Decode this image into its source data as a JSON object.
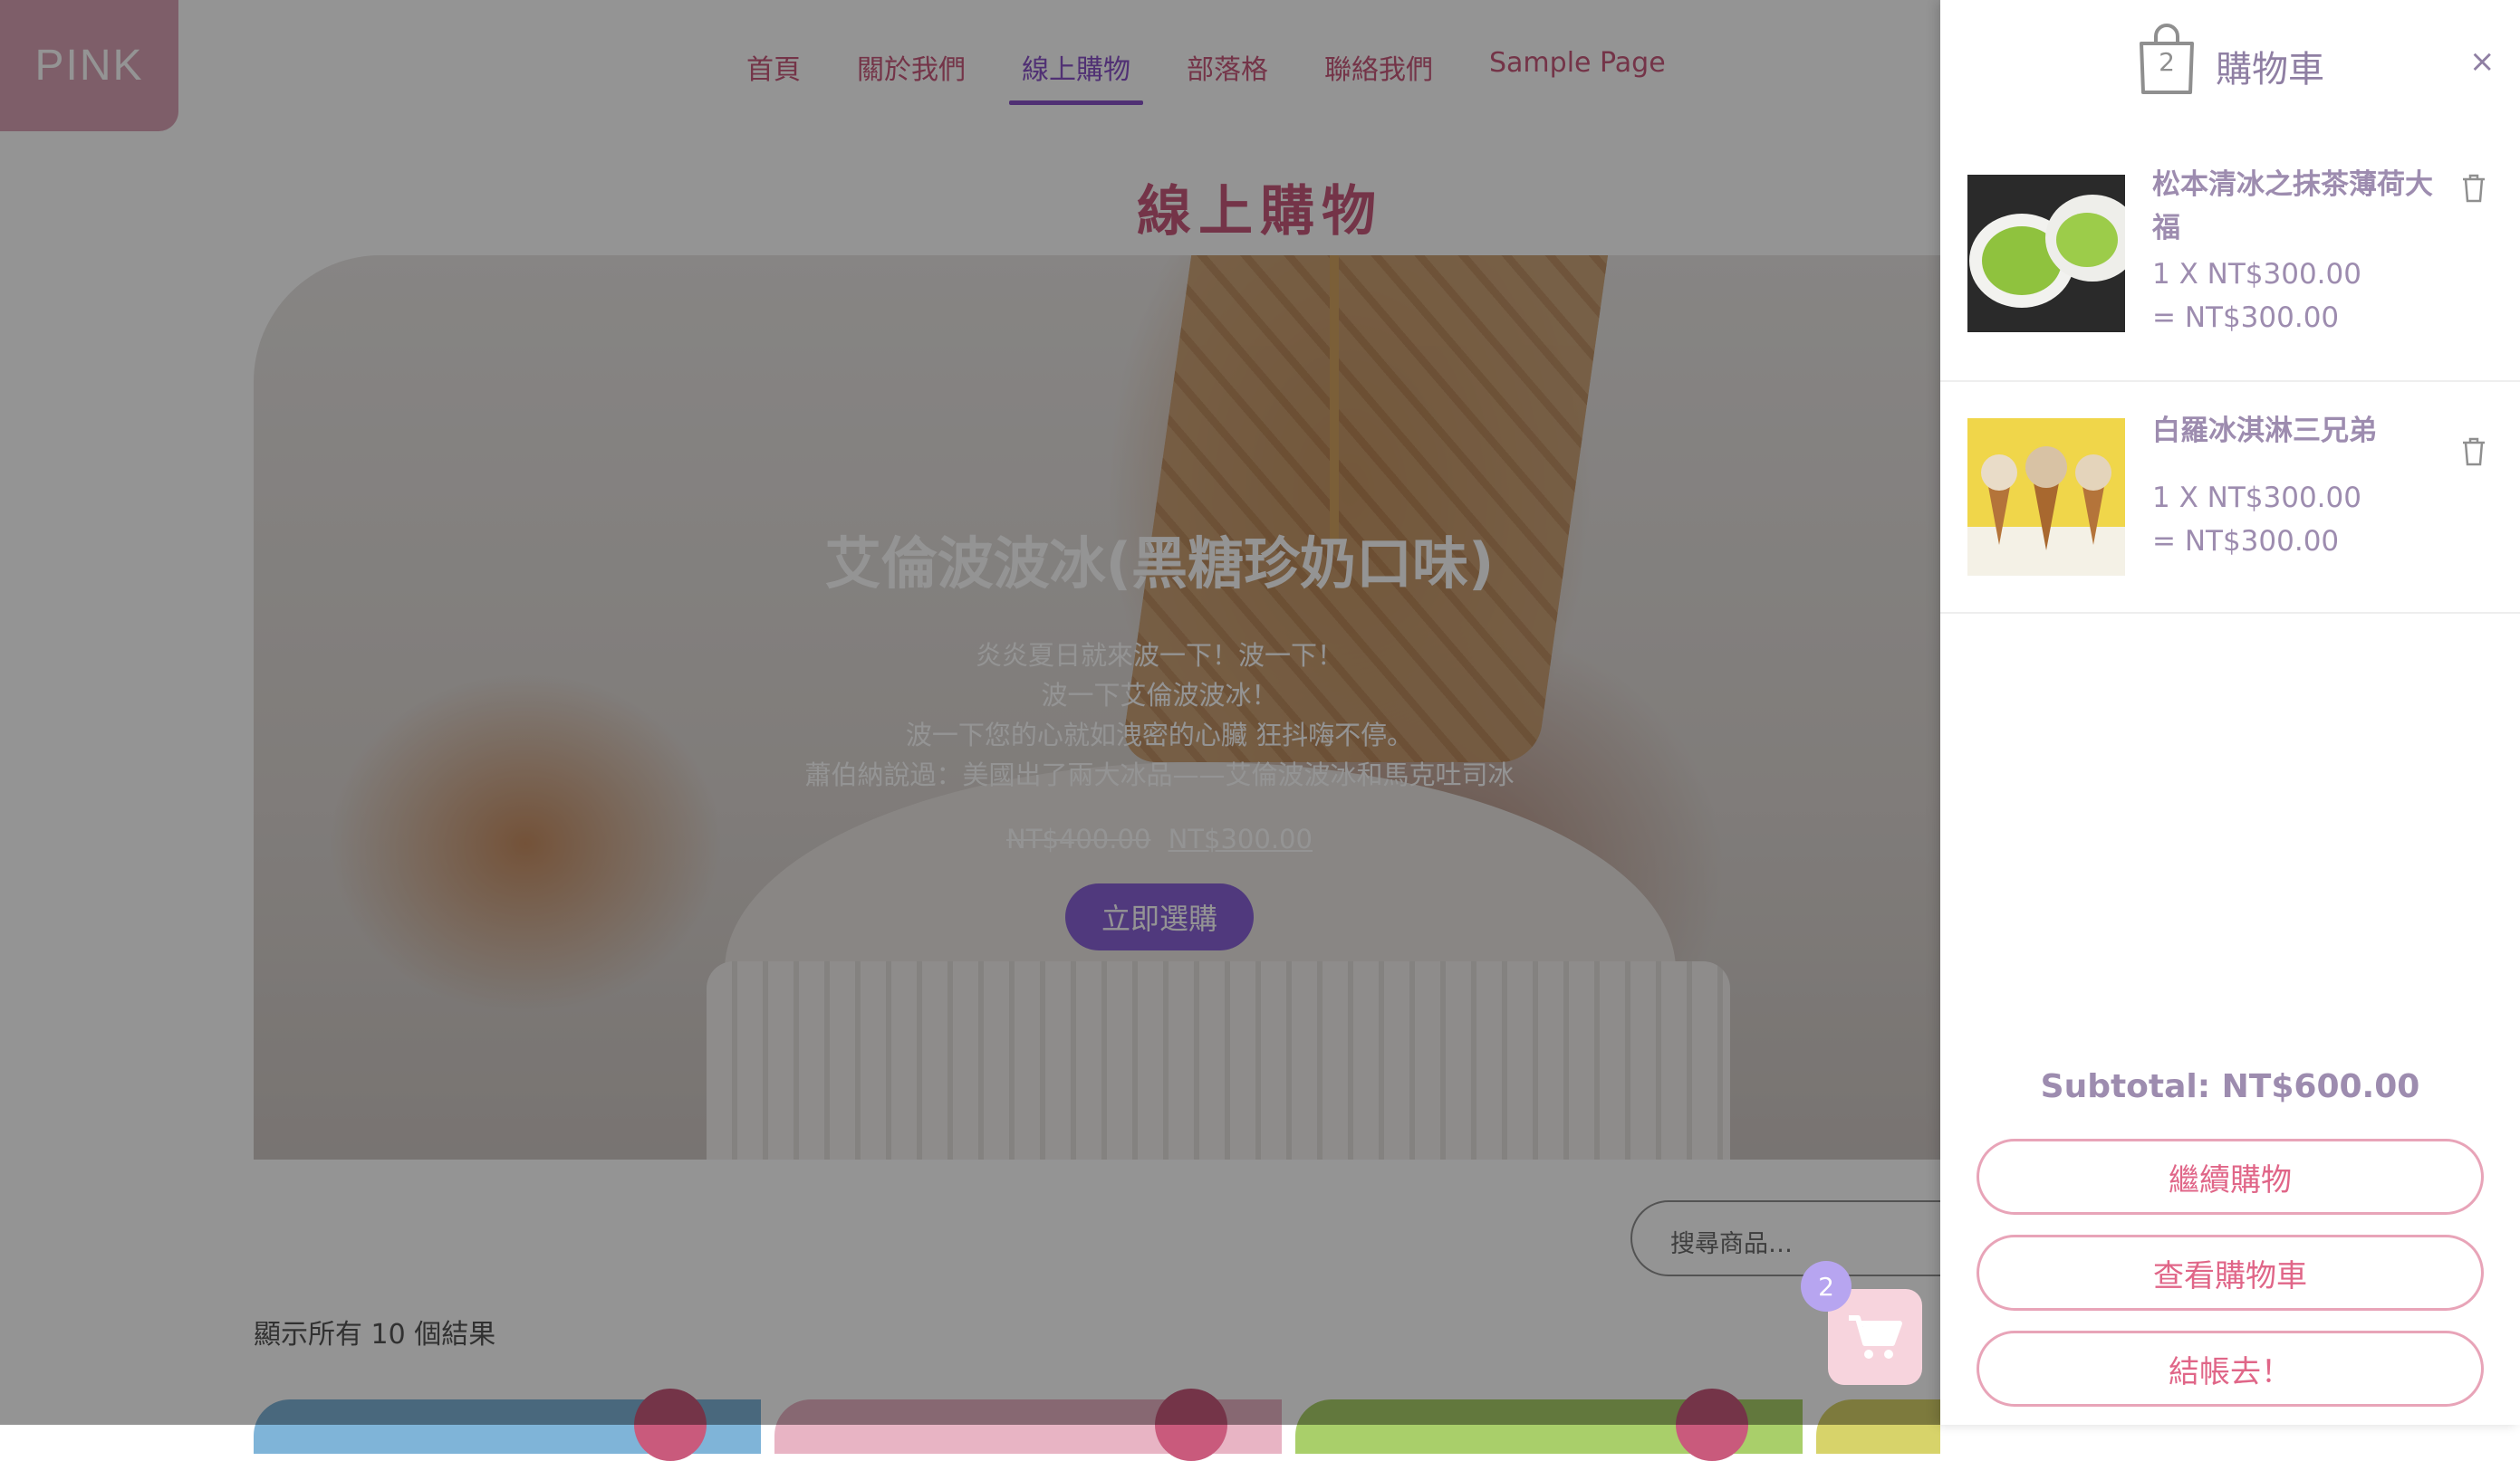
{
  "site": {
    "logo": "PINK"
  },
  "nav": {
    "items": [
      {
        "label": "首頁"
      },
      {
        "label": "關於我們"
      },
      {
        "label": "線上購物"
      },
      {
        "label": "部落格"
      },
      {
        "label": "聯絡我們"
      },
      {
        "label": "Sample Page"
      }
    ],
    "active_index": 2
  },
  "page": {
    "title": "線上購物"
  },
  "hero": {
    "title": "艾倫波波冰(黑糖珍奶口味)",
    "desc_lines": [
      "炎炎夏日就來波一下！波一下！",
      "波一下艾倫波波冰！",
      "波一下您的心就如洩密的心臟 狂抖嗨不停。",
      "蕭伯納說過：美國出了兩大冰品——艾倫波波冰和馬克吐司冰"
    ],
    "old_price": "NT$400.00",
    "new_price": "NT$300.00",
    "button_label": "立即選購"
  },
  "search": {
    "placeholder": "搜尋商品…"
  },
  "results": {
    "count_text": "顯示所有 10 個結果"
  },
  "float_cart": {
    "count": "2",
    "icon": "cart-icon"
  },
  "cart": {
    "count": "2",
    "title": "購物車",
    "close_label": "×",
    "items": [
      {
        "name": "松本清冰之抹茶薄荷大福",
        "qty_line": "1 X NT$300.00",
        "sub_line": "= NT$300.00"
      },
      {
        "name": "白羅冰淇淋三兄弟",
        "qty_line": "1 X NT$300.00",
        "sub_line": "= NT$300.00"
      }
    ],
    "subtotal": "Subtotal: NT$600.00",
    "buttons": {
      "continue": "繼續購物",
      "view": "查看購物車",
      "checkout": "結帳去！"
    }
  },
  "colors": {
    "accent_purple": "#8a53c8",
    "brand_pink": "#c95a7c",
    "button_pink": "#e06688",
    "drawer_text": "#9d8caf"
  }
}
